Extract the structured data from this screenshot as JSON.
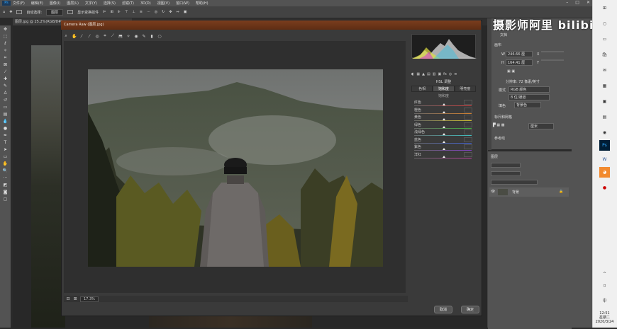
{
  "menubar": {
    "items": [
      "文件(F)",
      "编辑(E)",
      "图像(I)",
      "图层(L)",
      "文字(Y)",
      "选择(S)",
      "滤镜(T)",
      "3D(D)",
      "视图(V)",
      "窗口(W)",
      "帮助(H)"
    ],
    "logo": "Ps"
  },
  "optbar": {
    "auto_select_label": "自动选择:",
    "auto_select_value": "图层",
    "show_transform_label": "显示变换控件"
  },
  "document": {
    "tab_label": "图层.jpg @ 25.2%(RGB/8#) ×"
  },
  "camera_raw": {
    "title": "Camera Raw (图层.jpg)",
    "zoom": "17.3%",
    "cancel_label": "取消",
    "ok_label": "确定",
    "panel_title": "HSL 调整",
    "tabs": [
      "色相",
      "饱和度",
      "明亮度"
    ],
    "active_tab": 1,
    "sub_label": "饱和度",
    "hsl_rows": [
      {
        "label": "红色",
        "value": "0",
        "color": "#d04040"
      },
      {
        "label": "橙色",
        "value": "0",
        "color": "#d08030"
      },
      {
        "label": "黄色",
        "value": "0",
        "color": "#d0c030"
      },
      {
        "label": "绿色",
        "value": "0",
        "color": "#40b040"
      },
      {
        "label": "浅绿色",
        "value": "0",
        "color": "#40c0c0"
      },
      {
        "label": "蓝色",
        "value": "0",
        "color": "#4060d0"
      },
      {
        "label": "紫色",
        "value": "0",
        "color": "#8040c0"
      },
      {
        "label": "洋红",
        "value": "0",
        "color": "#c040a0"
      }
    ]
  },
  "properties": {
    "doc_label": "文档",
    "canvas_label": "画布",
    "width_label": "W",
    "width_value": "246.66 厘",
    "height_label": "H",
    "height_value": "164.41 厘",
    "x_label": "X",
    "y_label": "Y",
    "resolution_label": "分辨率: 72 像素/英寸",
    "mode_label": "模式",
    "mode_value": "RGB 颜色",
    "depth_value": "8 位/通道",
    "fill_label": "填色",
    "fill_value": "背景色",
    "rulers_label": "标尺和网格",
    "unit_value": "厘米",
    "guides_label": "参考线"
  },
  "layers": {
    "title": "图层",
    "layer_name": "背景"
  },
  "watermark": {
    "text": "摄影师阿里",
    "brand": "bilibili"
  },
  "taskbar": {
    "ime": "中",
    "time": "12:51",
    "weekday": "星期二",
    "date": "2020/3/24"
  }
}
